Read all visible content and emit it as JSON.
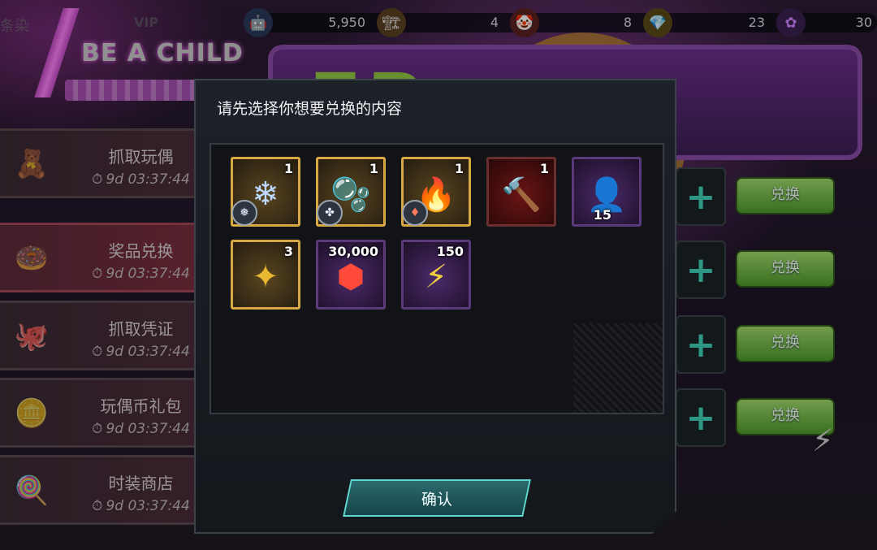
{
  "background": {
    "side_text": "条染",
    "vip_label": "VIP",
    "logo_text": "BE A CHILD",
    "marquee_text": "ER"
  },
  "resources": [
    {
      "icon": "robot-token-icon",
      "glyph": "🤖",
      "value": "5,950",
      "color": "#5a8ad0"
    },
    {
      "icon": "claw-machine-icon",
      "glyph": "🏗",
      "value": "4",
      "color": "#d0a050"
    },
    {
      "icon": "clown-face-icon",
      "glyph": "🤡",
      "value": "8",
      "color": "#d05050"
    },
    {
      "icon": "gem-face-icon",
      "glyph": "💎",
      "value": "23",
      "color": "#e0a030"
    },
    {
      "icon": "flower-face-icon",
      "glyph": "✿",
      "value": "30",
      "color": "#9a50d0"
    }
  ],
  "menu": [
    {
      "id": "grab-doll",
      "title": "抓取玩偶",
      "timer": "9d 03:37:44",
      "glyph": "🧸",
      "active": false
    },
    {
      "id": "prize-exchange",
      "title": "奖品兑换",
      "timer": "9d 03:37:44",
      "glyph": "🍩",
      "active": true
    },
    {
      "id": "grab-voucher",
      "title": "抓取凭证",
      "timer": "9d 03:37:44",
      "glyph": "🐙",
      "active": false
    },
    {
      "id": "doll-coin-pack",
      "title": "玩偶币礼包",
      "timer": "9d 03:37:44",
      "glyph": "🪙",
      "active": false
    },
    {
      "id": "fashion-shop",
      "title": "时装商店",
      "timer": "9d 03:37:44",
      "glyph": "🍭",
      "active": false
    }
  ],
  "slots": [
    {
      "button": "兑换"
    },
    {
      "button": "兑换"
    },
    {
      "button": "兑换"
    },
    {
      "button": "兑换"
    }
  ],
  "modal": {
    "title": "请先选择你想要兑换的内容",
    "confirm": "确认",
    "items": [
      {
        "name": "ice-crystal",
        "glyph": "❄",
        "qty": "1",
        "frame": "gold",
        "badge": "❅",
        "color": "#bcd8ff"
      },
      {
        "name": "water-orbs",
        "glyph": "🫧",
        "qty": "1",
        "frame": "gold",
        "badge": "✤",
        "color": "#40c8e8"
      },
      {
        "name": "fire-crystal",
        "glyph": "🔥",
        "qty": "1",
        "frame": "gold",
        "badge": "♦",
        "color": "#ff8a40"
      },
      {
        "name": "war-hammer",
        "glyph": "🔨",
        "qty": "1",
        "frame": "red",
        "badge": "",
        "color": "#c0c0c0"
      },
      {
        "name": "character-card",
        "glyph": "👤",
        "qty": "15",
        "frame": "purple",
        "badge": "",
        "color": "#e070f0"
      },
      {
        "name": "gold-shard",
        "glyph": "✦",
        "qty": "3",
        "frame": "gold",
        "badge": "",
        "color": "#e8b830"
      },
      {
        "name": "red-emblem",
        "glyph": "⬢",
        "qty": "30,000",
        "frame": "purple",
        "badge": "",
        "color": "#ff4a3a"
      },
      {
        "name": "energy-coin",
        "glyph": "⚡",
        "qty": "150",
        "frame": "purple",
        "badge": "",
        "color": "#f0d040"
      }
    ]
  }
}
